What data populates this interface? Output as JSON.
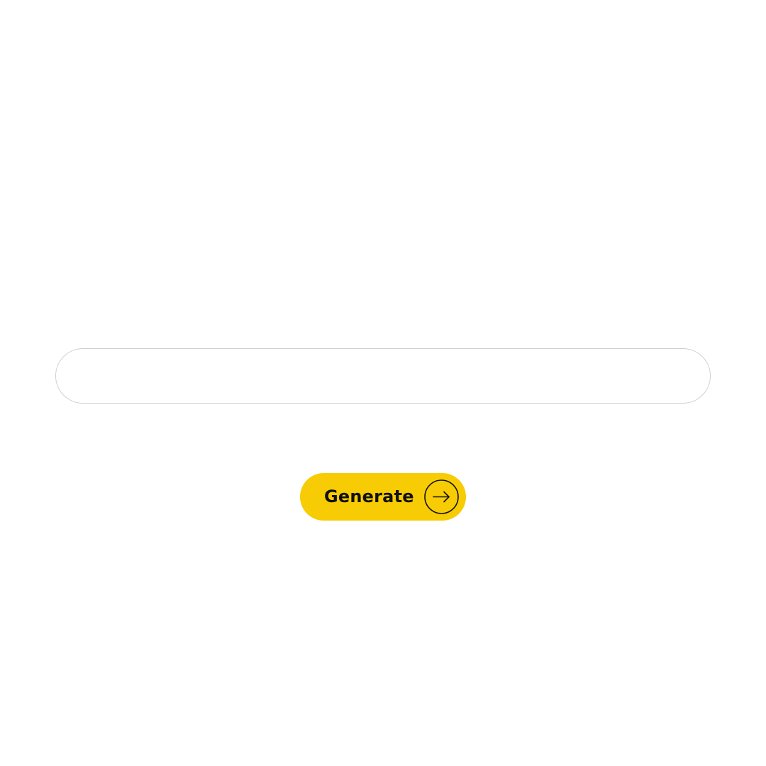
{
  "prompt": {
    "value": "",
    "placeholder": ""
  },
  "generate_button": {
    "label": "Generate",
    "icon": "arrow-right-circle-icon"
  },
  "colors": {
    "background": "#ffffff",
    "field_border": "#cfcfcf",
    "accent": "#f7cc04",
    "text": "#111111"
  }
}
